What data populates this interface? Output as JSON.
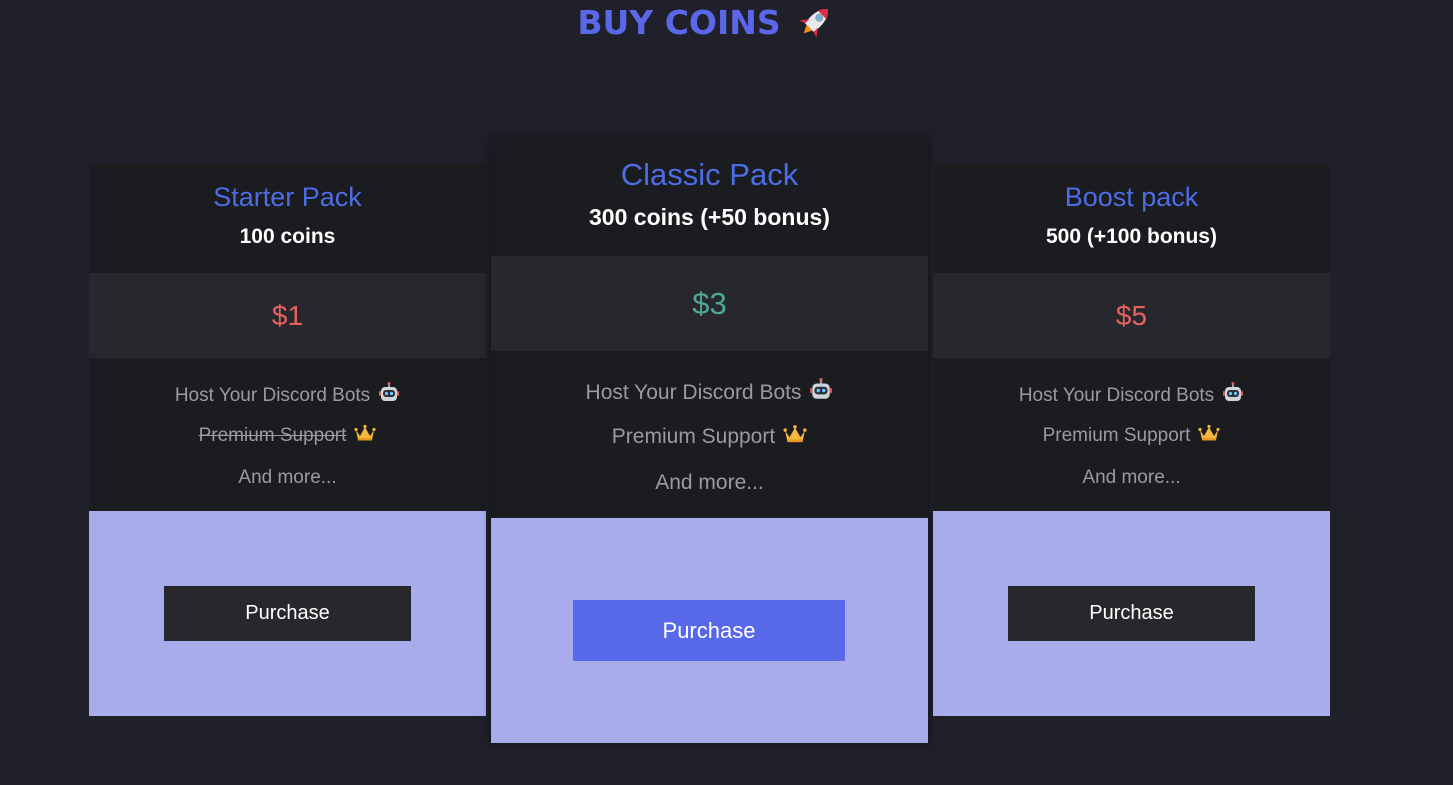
{
  "header": {
    "title": "BUY COINS"
  },
  "packs": [
    {
      "name": "Starter Pack",
      "coins": "100 coins",
      "price": "$1",
      "price_color": "#e9605f",
      "features": [
        "Host Your Discord Bots",
        "Premium Support",
        "And more..."
      ],
      "premium_struck": true,
      "button": "Purchase"
    },
    {
      "name": "Classic Pack",
      "coins": "300 coins (+50 bonus)",
      "price": "$3",
      "price_color": "#4fa795",
      "features": [
        "Host Your Discord Bots",
        "Premium Support",
        "And more..."
      ],
      "premium_struck": false,
      "button": "Purchase"
    },
    {
      "name": "Boost pack",
      "coins": "500 (+100 bonus)",
      "price": "$5",
      "price_color": "#e9605f",
      "features": [
        "Host Your Discord Bots",
        "Premium Support",
        "And more..."
      ],
      "premium_struck": false,
      "button": "Purchase"
    }
  ],
  "colors": {
    "background": "#1f2029",
    "accent": "#5a67e8",
    "buy_area": "#a8acea",
    "featured_button": "#5768e9",
    "button": "#27282c"
  }
}
